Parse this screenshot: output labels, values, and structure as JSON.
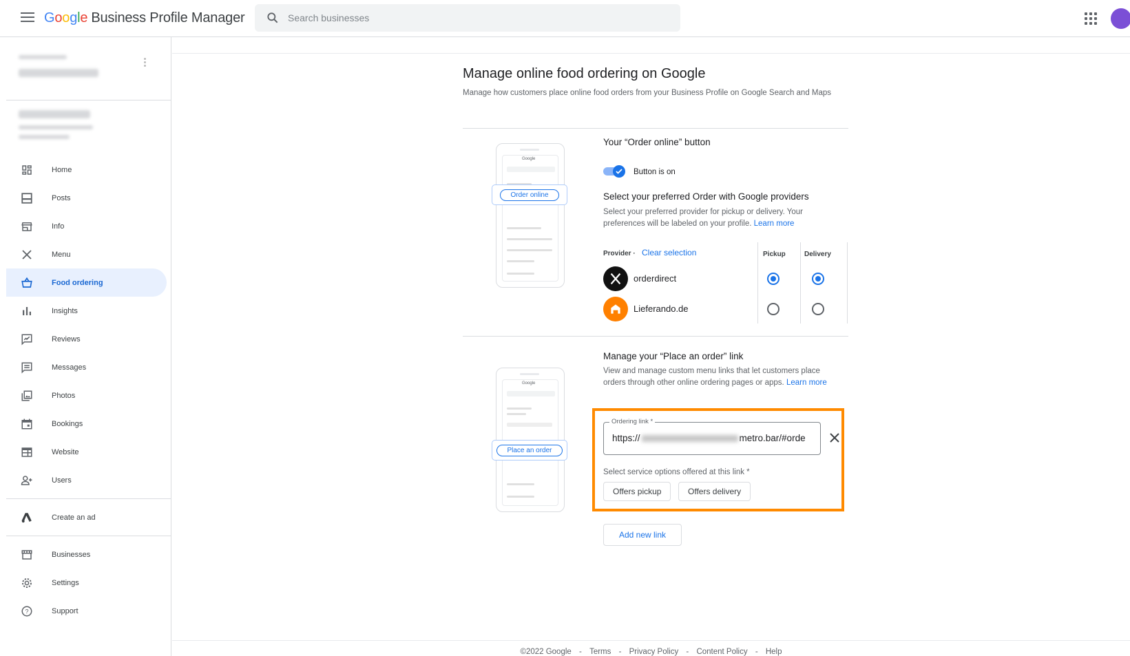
{
  "header": {
    "logo_google": [
      "G",
      "o",
      "o",
      "g",
      "l",
      "e"
    ],
    "logo_rest": "Business Profile Manager",
    "search_placeholder": "Search businesses"
  },
  "sidebar": {
    "items": [
      {
        "label": "Home",
        "icon": "dashboard-icon"
      },
      {
        "label": "Posts",
        "icon": "posts-icon"
      },
      {
        "label": "Info",
        "icon": "storefront-icon"
      },
      {
        "label": "Menu",
        "icon": "utensils-icon"
      },
      {
        "label": "Food ordering",
        "icon": "shopping-basket-icon"
      },
      {
        "label": "Insights",
        "icon": "bar-chart-icon"
      },
      {
        "label": "Reviews",
        "icon": "reviews-icon"
      },
      {
        "label": "Messages",
        "icon": "chat-icon"
      },
      {
        "label": "Photos",
        "icon": "photos-icon"
      },
      {
        "label": "Bookings",
        "icon": "calendar-icon"
      },
      {
        "label": "Website",
        "icon": "web-icon"
      },
      {
        "label": "Users",
        "icon": "add-user-icon"
      },
      {
        "label": "Create an ad",
        "icon": "google-ads-icon"
      },
      {
        "label": "Businesses",
        "icon": "store-icon"
      },
      {
        "label": "Settings",
        "icon": "gear-icon"
      },
      {
        "label": "Support",
        "icon": "help-icon"
      }
    ]
  },
  "main": {
    "title": "Manage online food ordering on Google",
    "subtitle": "Manage how customers place online food orders from your Business Profile on Google Search and Maps",
    "order_online": {
      "phone_button": "Order online",
      "heading": "Your “Order online” button",
      "toggle_label": "Button is on",
      "providers_heading": "Select your preferred Order with Google providers",
      "providers_desc": "Select your preferred provider for pickup or delivery. Your preferences will be labeled on your profile.",
      "learn_more": "Learn more",
      "col_provider": "Provider ·",
      "clear_selection": "Clear selection",
      "col_pickup": "Pickup",
      "col_delivery": "Delivery",
      "providers": [
        {
          "name": "orderdirect",
          "pickup": true,
          "delivery": true
        },
        {
          "name": "Lieferando.de",
          "pickup": false,
          "delivery": false
        }
      ]
    },
    "place_order": {
      "phone_button": "Place an order",
      "heading": "Manage your “Place an order” link",
      "desc": "View and manage custom menu links that let customers place orders through other online ordering pages or apps.",
      "learn_more": "Learn more",
      "field_label": "Ordering link *",
      "field_prefix": "https://",
      "field_suffix": "metro.bar/#orde",
      "service_label": "Select service options offered at this link *",
      "chip_pickup": "Offers pickup",
      "chip_delivery": "Offers delivery",
      "add_link": "Add new link"
    }
  },
  "footer": {
    "copyright": "©2022 Google",
    "sep": "-",
    "links": [
      "Terms",
      "Privacy Policy",
      "Content Policy",
      "Help"
    ]
  },
  "colors": {
    "accent": "#1a73e8",
    "highlight": "#ff8a00",
    "active_bg": "#e8f0fe"
  }
}
